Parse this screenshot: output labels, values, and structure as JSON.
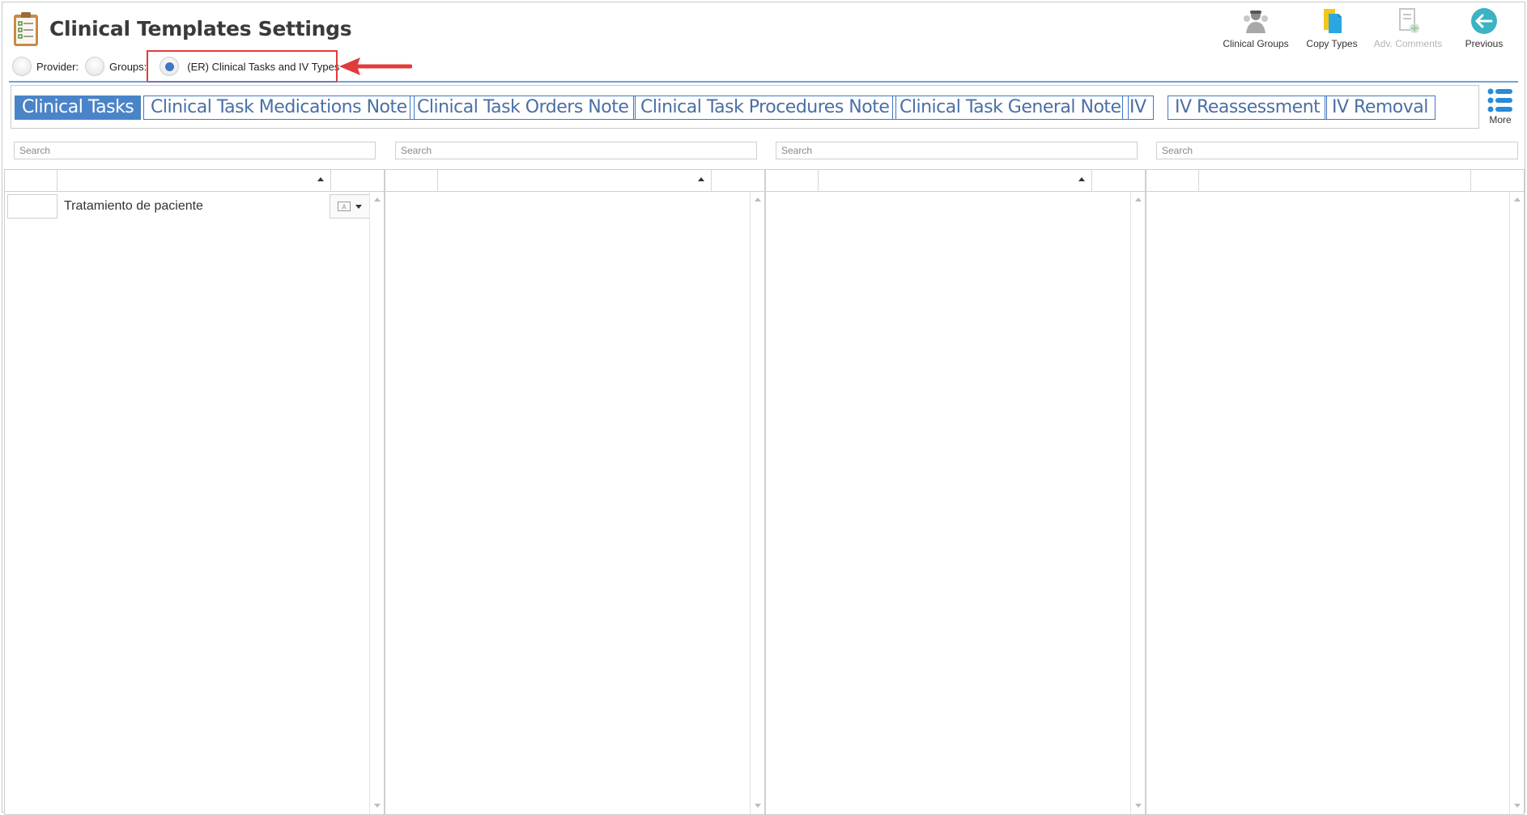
{
  "header": {
    "title": "Clinical Templates Settings"
  },
  "filters": {
    "provider_label": "Provider:",
    "groups_label": "Groups:",
    "er_label": "(ER) Clinical Tasks and IV Types",
    "selected": "er"
  },
  "toolbar": {
    "clinical_groups": "Clinical Groups",
    "copy_types": "Copy Types",
    "adv_comments": "Adv. Comments",
    "previous": "Previous"
  },
  "tabs": [
    {
      "label": "Clinical Tasks",
      "active": true
    },
    {
      "label": "Clinical Task Medications Note",
      "active": false
    },
    {
      "label": "Clinical Task Orders Note",
      "active": false
    },
    {
      "label": "Clinical Task Procedures Note",
      "active": false
    },
    {
      "label": "Clinical Task General Note",
      "active": false
    },
    {
      "label": "IV",
      "active": false
    },
    {
      "label": "IV Reassessment",
      "active": false
    },
    {
      "label": "IV Removal",
      "active": false
    }
  ],
  "more_label": "More",
  "search_placeholder": "Search",
  "grids": [
    {
      "rows": [
        {
          "name": "Tratamiento de paciente"
        }
      ]
    },
    {
      "rows": []
    },
    {
      "rows": []
    },
    {
      "rows": []
    }
  ],
  "colors": {
    "accent": "#4a84c8",
    "highlight": "#e23b3b",
    "disabled": "#b5b5b5"
  }
}
